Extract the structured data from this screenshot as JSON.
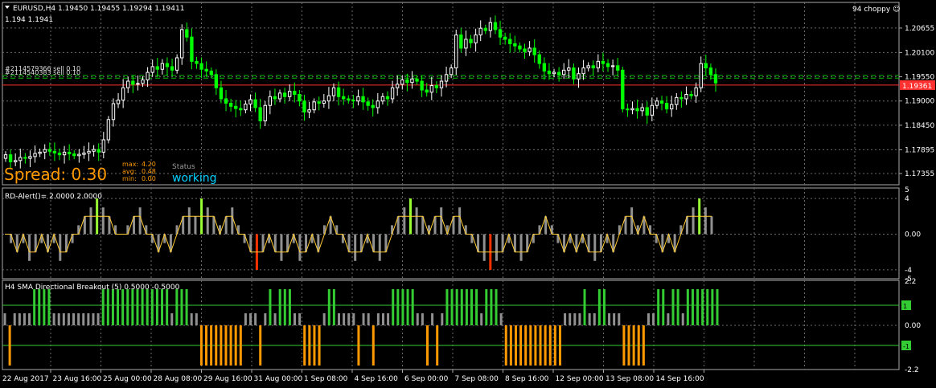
{
  "chart_header": {
    "symbol_line": "EURUSD,H4  1.19450 1.19455 1.19294 1.19411",
    "sub_line": "1.194    1.1941",
    "mode_label": "94 choppy",
    "order_labels": [
      "#2114579366 sell 0.10",
      "#2114540383 sell 0.10"
    ]
  },
  "spread_panel": {
    "spread_text": "Spread: 0.30",
    "max_label": "max:",
    "max_value": "4.20",
    "avg_label": "avg:",
    "avg_value": "0.48",
    "min_label": "min:",
    "min_value": "0.00",
    "status_label": "Status",
    "status_value": "working"
  },
  "indicator1": {
    "label": "RD-Alert()=  2.0000 2.0000"
  },
  "indicator2": {
    "label": "H4 SMA Directional Breakout (5) 0.5000 -0.5000"
  },
  "colors": {
    "bg": "#000000",
    "grid": "#6b6b6b",
    "bull_candle": "#ffffff",
    "bear_candle": "#00ff00",
    "price_line_red": "#ff3030",
    "order_line_green": "#00c000",
    "spread_orange": "#ff9900",
    "status_cyan": "#00d0ff",
    "histo_lime": "#99ff33",
    "histo_gray": "#909090",
    "histo_red": "#ff3300",
    "histo_green": "#33cc33",
    "histo_orange": "#ff9900",
    "signal_line": "#ffcc33"
  },
  "chart_data": [
    {
      "type": "candlestick",
      "symbol": "EURUSD",
      "timeframe": "H4",
      "ylim": [
        1.171,
        1.21
      ],
      "y_ticks": [
        "1.20655",
        "1.20100",
        "1.19550",
        "1.19000",
        "1.18450",
        "1.17895",
        "1.17355"
      ],
      "y_tick_values": [
        1.20655,
        1.201,
        1.1955,
        1.19,
        1.1845,
        1.17895,
        1.17355
      ],
      "current_price_label": "1.19361",
      "current_price": 1.19361,
      "order_lines": [
        1.1958,
        1.1952
      ],
      "x_labels": [
        "22 Aug 2017",
        "23 Aug 16:00",
        "25 Aug 00:00",
        "28 Aug 08:00",
        "29 Aug 16:00",
        "31 Aug 00:00",
        "1 Sep 08:00",
        "4 Sep 16:00",
        "6 Sep 00:00",
        "7 Sep 08:00",
        "8 Sep 16:00",
        "12 Sep 00:00",
        "13 Sep 08:00",
        "14 Sep 16:00"
      ],
      "closes": [
        1.1778,
        1.1762,
        1.1765,
        1.1772,
        1.177,
        1.1774,
        1.1781,
        1.1784,
        1.179,
        1.1786,
        1.1782,
        1.1778,
        1.1784,
        1.178,
        1.1776,
        1.1779,
        1.1782,
        1.1786,
        1.179,
        1.1784,
        1.1812,
        1.1858,
        1.1894,
        1.1902,
        1.193,
        1.1945,
        1.1938,
        1.194,
        1.1948,
        1.1965,
        1.1978,
        1.1972,
        1.1985,
        1.1978,
        1.197,
        1.1998,
        1.2062,
        1.2045,
        1.199,
        1.1985,
        1.1972,
        1.1968,
        1.196,
        1.193,
        1.1905,
        1.1895,
        1.1888,
        1.1883,
        1.188,
        1.1893,
        1.1903,
        1.1885,
        1.1855,
        1.189,
        1.191,
        1.1905,
        1.1918,
        1.191,
        1.1922,
        1.1915,
        1.19,
        1.1875,
        1.188,
        1.1898,
        1.1895,
        1.19,
        1.1912,
        1.193,
        1.191,
        1.1905,
        1.1902,
        1.19,
        1.191,
        1.1898,
        1.189,
        1.1885,
        1.19,
        1.191,
        1.1905,
        1.193,
        1.1938,
        1.1948,
        1.1942,
        1.195,
        1.1945,
        1.1925,
        1.192,
        1.1935,
        1.193,
        1.1945,
        1.196,
        1.1975,
        1.205,
        1.202,
        1.204,
        1.2032,
        1.205,
        1.2065,
        1.206,
        1.2078,
        1.2062,
        1.2045,
        1.204,
        1.203,
        1.2025,
        1.2018,
        1.2012,
        1.202,
        1.2005,
        1.1985,
        1.1968,
        1.1962,
        1.1965,
        1.196,
        1.197,
        1.1975,
        1.195,
        1.1962,
        1.1975,
        1.198,
        1.1975,
        1.199,
        1.1985,
        1.1978,
        1.198,
        1.197,
        1.1882,
        1.188,
        1.1883,
        1.1878,
        1.1885,
        1.1868,
        1.189,
        1.19,
        1.1895,
        1.1882,
        1.1892,
        1.1908,
        1.1905,
        1.1915,
        1.1912,
        1.193,
        1.1985,
        1.1975,
        1.196,
        1.1941
      ]
    },
    {
      "type": "histogram",
      "name": "RD-Alert",
      "ylim": [
        -5,
        5
      ],
      "y_ticks": [
        "5",
        "4",
        "0.00",
        "-4",
        "-5"
      ],
      "values": [
        0,
        -1,
        -2,
        -1,
        -3,
        -2,
        -1,
        -2,
        -1,
        -3,
        -2,
        -1,
        1,
        2,
        3,
        4,
        3,
        2,
        1,
        0,
        1,
        2,
        3,
        1,
        -1,
        -2,
        -1,
        -2,
        1,
        2,
        3,
        2,
        4,
        3,
        2,
        1,
        2,
        3,
        1,
        -1,
        -2,
        -4,
        -2,
        -1,
        -2,
        -3,
        -2,
        -1,
        -3,
        -2,
        -1,
        -2,
        1,
        2,
        1,
        -1,
        -2,
        -3,
        -2,
        -1,
        -2,
        -3,
        -2,
        1,
        2,
        3,
        4,
        3,
        2,
        1,
        2,
        3,
        1,
        2,
        3,
        1,
        -1,
        -2,
        -3,
        -4,
        -3,
        -2,
        -1,
        -2,
        -3,
        -2,
        -1,
        1,
        2,
        1,
        -1,
        -2,
        -1,
        -2,
        -1,
        -2,
        -3,
        -2,
        -1,
        -2,
        1,
        2,
        3,
        1,
        2,
        1,
        -1,
        -2,
        -1,
        -2,
        1,
        2,
        3,
        4,
        3,
        2
      ],
      "signal_highs": [
        2,
        2,
        2,
        2,
        2,
        2,
        2,
        2,
        2,
        2
      ],
      "signal_low": -2
    },
    {
      "type": "histogram",
      "name": "H4 SMA Directional Breakout (5)",
      "ylim": [
        -2.2,
        2.2
      ],
      "y_ticks": [
        "2.2",
        "1",
        "0.00",
        "-1",
        "-2.2"
      ],
      "levels": [
        1,
        -1
      ]
    }
  ]
}
